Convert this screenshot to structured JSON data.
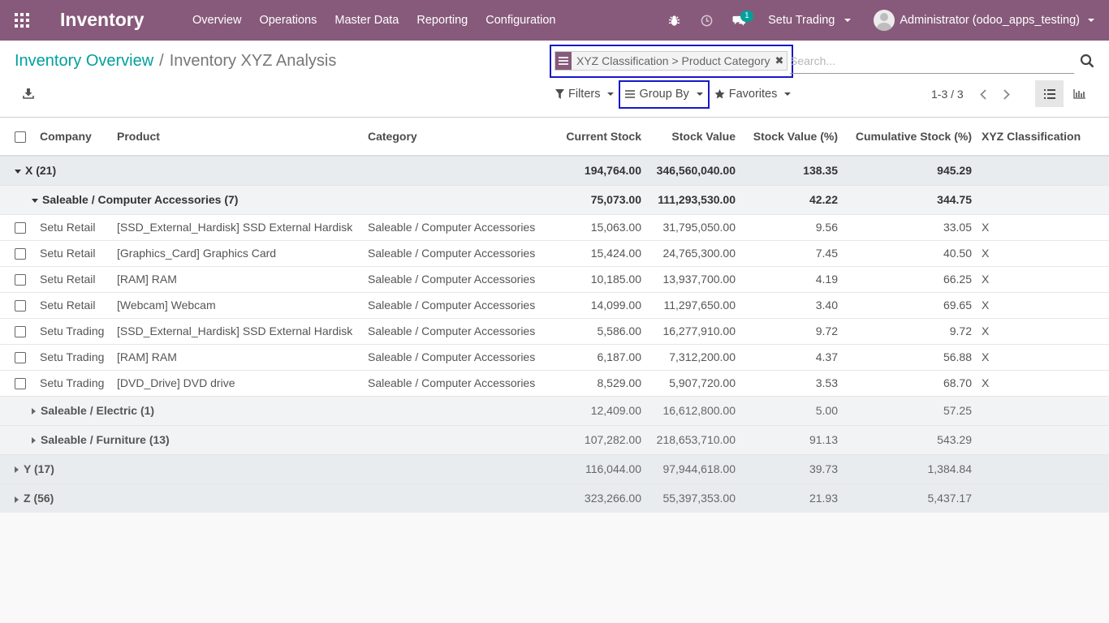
{
  "navbar": {
    "brand": "Inventory",
    "menu": [
      "Overview",
      "Operations",
      "Master Data",
      "Reporting",
      "Configuration"
    ],
    "messages_badge": "1",
    "company": "Setu Trading",
    "user": "Administrator (odoo_apps_testing)"
  },
  "breadcrumb": {
    "parent": "Inventory Overview",
    "separator": "/",
    "current": "Inventory XYZ Analysis"
  },
  "search": {
    "facet_label": "XYZ Classification > Product Category",
    "placeholder": "Search..."
  },
  "controls": {
    "filters": "Filters",
    "group_by": "Group By",
    "favorites": "Favorites",
    "pager": "1-3 / 3"
  },
  "columns": [
    "Company",
    "Product",
    "Category",
    "Current Stock",
    "Stock Value",
    "Stock Value (%)",
    "Cumulative Stock (%)",
    "XYZ Classification"
  ],
  "groups": {
    "x": {
      "label": "X (21)",
      "stock": "194,764.00",
      "value": "346,560,040.00",
      "value_pct": "138.35",
      "cum_pct": "945.29"
    },
    "x_comp": {
      "label": "Saleable / Computer Accessories (7)",
      "stock": "75,073.00",
      "value": "111,293,530.00",
      "value_pct": "42.22",
      "cum_pct": "344.75"
    },
    "x_elec": {
      "label": "Saleable / Electric (1)",
      "stock": "12,409.00",
      "value": "16,612,800.00",
      "value_pct": "5.00",
      "cum_pct": "57.25"
    },
    "x_furn": {
      "label": "Saleable / Furniture (13)",
      "stock": "107,282.00",
      "value": "218,653,710.00",
      "value_pct": "91.13",
      "cum_pct": "543.29"
    },
    "y": {
      "label": "Y (17)",
      "stock": "116,044.00",
      "value": "97,944,618.00",
      "value_pct": "39.73",
      "cum_pct": "1,384.84"
    },
    "z": {
      "label": "Z (56)",
      "stock": "323,266.00",
      "value": "55,397,353.00",
      "value_pct": "21.93",
      "cum_pct": "5,437.17"
    }
  },
  "rows": [
    {
      "company": "Setu Retail",
      "product": "[SSD_External_Hardisk] SSD External Hardisk",
      "category": "Saleable / Computer Accessories",
      "stock": "15,063.00",
      "value": "31,795,050.00",
      "value_pct": "9.56",
      "cum_pct": "33.05",
      "xyz": "X"
    },
    {
      "company": "Setu Retail",
      "product": "[Graphics_Card] Graphics Card",
      "category": "Saleable / Computer Accessories",
      "stock": "15,424.00",
      "value": "24,765,300.00",
      "value_pct": "7.45",
      "cum_pct": "40.50",
      "xyz": "X"
    },
    {
      "company": "Setu Retail",
      "product": "[RAM] RAM",
      "category": "Saleable / Computer Accessories",
      "stock": "10,185.00",
      "value": "13,937,700.00",
      "value_pct": "4.19",
      "cum_pct": "66.25",
      "xyz": "X"
    },
    {
      "company": "Setu Retail",
      "product": "[Webcam] Webcam",
      "category": "Saleable / Computer Accessories",
      "stock": "14,099.00",
      "value": "11,297,650.00",
      "value_pct": "3.40",
      "cum_pct": "69.65",
      "xyz": "X"
    },
    {
      "company": "Setu Trading",
      "product": "[SSD_External_Hardisk] SSD External Hardisk",
      "category": "Saleable / Computer Accessories",
      "stock": "5,586.00",
      "value": "16,277,910.00",
      "value_pct": "9.72",
      "cum_pct": "9.72",
      "xyz": "X"
    },
    {
      "company": "Setu Trading",
      "product": "[RAM] RAM",
      "category": "Saleable / Computer Accessories",
      "stock": "6,187.00",
      "value": "7,312,200.00",
      "value_pct": "4.37",
      "cum_pct": "56.88",
      "xyz": "X"
    },
    {
      "company": "Setu Trading",
      "product": "[DVD_Drive] DVD drive",
      "category": "Saleable / Computer Accessories",
      "stock": "8,529.00",
      "value": "5,907,720.00",
      "value_pct": "3.53",
      "cum_pct": "68.70",
      "xyz": "X"
    }
  ],
  "colors": {
    "brand": "#875a7b",
    "link": "#00a09d",
    "highlight_frame": "#1818c8"
  },
  "icons": [
    "apps-icon",
    "bug-icon",
    "clock-icon",
    "chat-icon",
    "download-icon",
    "search-icon",
    "filter-icon",
    "group-by-icon",
    "star-icon",
    "chevron-left-icon",
    "chevron-right-icon",
    "list-view-icon",
    "graph-view-icon"
  ]
}
